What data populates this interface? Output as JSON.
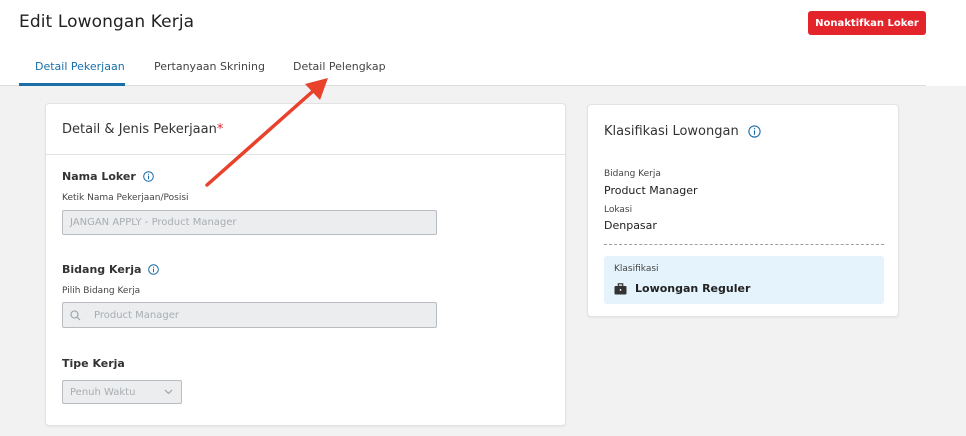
{
  "header": {
    "title": "Edit Lowongan Kerja",
    "deactivate_label": "Nonaktifkan Loker"
  },
  "tabs": [
    {
      "label": "Detail Pekerjaan",
      "active": true
    },
    {
      "label": "Pertanyaan Skrining",
      "active": false
    },
    {
      "label": "Detail Pelengkap",
      "active": false
    }
  ],
  "left_card": {
    "title": "Detail & Jenis Pekerjaan",
    "required_marker": "*",
    "job_name": {
      "label": "Nama Loker",
      "hint": "Ketik Nama Pekerjaan/Posisi",
      "value": "JANGAN APPLY - Product Manager"
    },
    "field": {
      "label": "Bidang Kerja",
      "hint": "Pilih Bidang Kerja",
      "value": "Product Manager"
    },
    "job_type": {
      "label": "Tipe Kerja",
      "value": "Penuh Waktu"
    }
  },
  "right_card": {
    "title": "Klasifikasi Lowongan",
    "field_label": "Bidang Kerja",
    "field_value": "Product Manager",
    "location_label": "Lokasi",
    "location_value": "Denpasar",
    "classification_label": "Klasifikasi",
    "classification_value": "Lowongan Reguler"
  },
  "colors": {
    "accent": "#1b6fa8",
    "danger": "#e3242b",
    "annotation_arrow": "#e8412c",
    "info_box": "#e5f4fc"
  },
  "icons": {
    "info": "info-circle-icon",
    "search": "search-icon",
    "chevron": "chevron-down-icon",
    "briefcase": "briefcase-icon"
  }
}
